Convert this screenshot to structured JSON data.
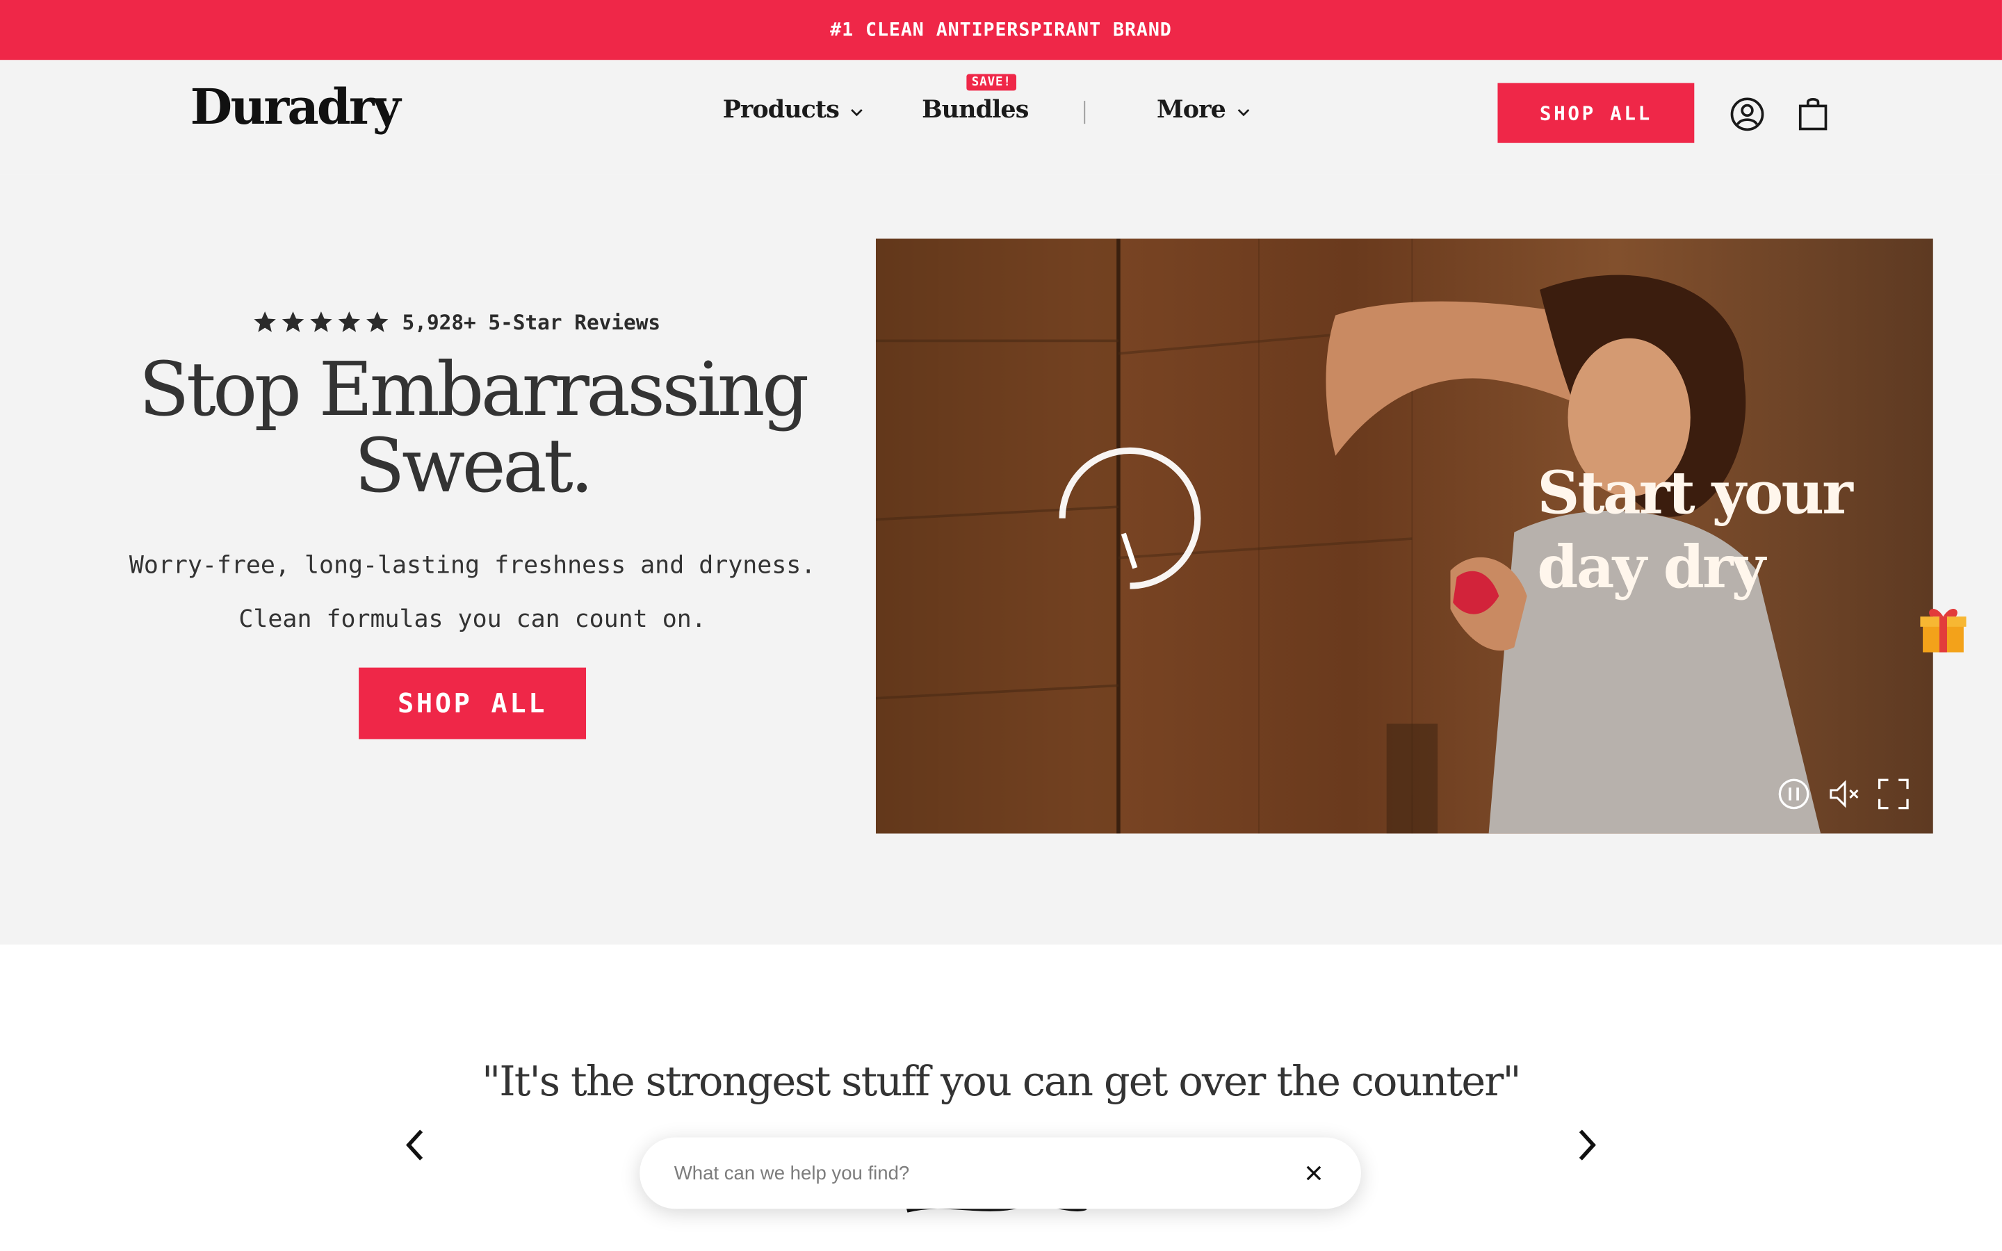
{
  "announcement": {
    "text": "#1 CLEAN ANTIPERSPIRANT BRAND"
  },
  "header": {
    "logo": "Duradry",
    "nav": [
      {
        "label": "Products",
        "has_dropdown": true
      },
      {
        "label": "Bundles",
        "badge": "SAVE!"
      },
      {
        "label": "More",
        "has_dropdown": true
      }
    ],
    "shop_all_label": "SHOP ALL",
    "icons": [
      "account-icon",
      "cart-icon"
    ]
  },
  "hero": {
    "rating_text": "5,928+ 5-Star Reviews",
    "stars": 5,
    "title_line1": "Stop Embarrassing",
    "title_line2": "Sweat.",
    "subtitle": "Worry-free, long-lasting freshness and dryness. Clean formulas you can count on.",
    "cta_label": "SHOP ALL",
    "video": {
      "caption_line1": "Start your",
      "caption_line2": "day dry",
      "controls": [
        "pause-icon",
        "mute-icon",
        "fullscreen-icon"
      ]
    }
  },
  "testimonial": {
    "quote": "\"It's the strongest stuff you can get over the counter\""
  },
  "search": {
    "placeholder": "What can we help you find?"
  },
  "colors": {
    "brand_red": "#ef2748",
    "hero_bg": "#f3f3f3",
    "text_dark": "#333333"
  }
}
